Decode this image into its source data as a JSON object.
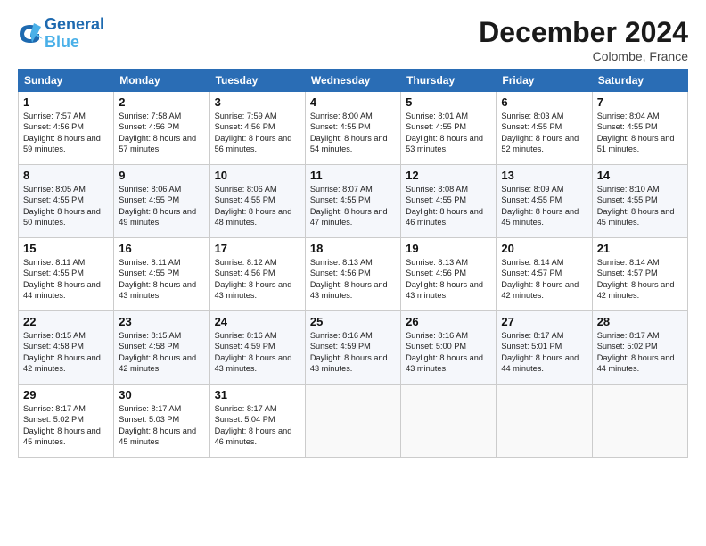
{
  "header": {
    "logo_line1": "General",
    "logo_line2": "Blue",
    "main_title": "December 2024",
    "subtitle": "Colombe, France"
  },
  "days_of_week": [
    "Sunday",
    "Monday",
    "Tuesday",
    "Wednesday",
    "Thursday",
    "Friday",
    "Saturday"
  ],
  "weeks": [
    [
      {
        "day": "1",
        "sunrise": "Sunrise: 7:57 AM",
        "sunset": "Sunset: 4:56 PM",
        "daylight": "Daylight: 8 hours and 59 minutes."
      },
      {
        "day": "2",
        "sunrise": "Sunrise: 7:58 AM",
        "sunset": "Sunset: 4:56 PM",
        "daylight": "Daylight: 8 hours and 57 minutes."
      },
      {
        "day": "3",
        "sunrise": "Sunrise: 7:59 AM",
        "sunset": "Sunset: 4:56 PM",
        "daylight": "Daylight: 8 hours and 56 minutes."
      },
      {
        "day": "4",
        "sunrise": "Sunrise: 8:00 AM",
        "sunset": "Sunset: 4:55 PM",
        "daylight": "Daylight: 8 hours and 54 minutes."
      },
      {
        "day": "5",
        "sunrise": "Sunrise: 8:01 AM",
        "sunset": "Sunset: 4:55 PM",
        "daylight": "Daylight: 8 hours and 53 minutes."
      },
      {
        "day": "6",
        "sunrise": "Sunrise: 8:03 AM",
        "sunset": "Sunset: 4:55 PM",
        "daylight": "Daylight: 8 hours and 52 minutes."
      },
      {
        "day": "7",
        "sunrise": "Sunrise: 8:04 AM",
        "sunset": "Sunset: 4:55 PM",
        "daylight": "Daylight: 8 hours and 51 minutes."
      }
    ],
    [
      {
        "day": "8",
        "sunrise": "Sunrise: 8:05 AM",
        "sunset": "Sunset: 4:55 PM",
        "daylight": "Daylight: 8 hours and 50 minutes."
      },
      {
        "day": "9",
        "sunrise": "Sunrise: 8:06 AM",
        "sunset": "Sunset: 4:55 PM",
        "daylight": "Daylight: 8 hours and 49 minutes."
      },
      {
        "day": "10",
        "sunrise": "Sunrise: 8:06 AM",
        "sunset": "Sunset: 4:55 PM",
        "daylight": "Daylight: 8 hours and 48 minutes."
      },
      {
        "day": "11",
        "sunrise": "Sunrise: 8:07 AM",
        "sunset": "Sunset: 4:55 PM",
        "daylight": "Daylight: 8 hours and 47 minutes."
      },
      {
        "day": "12",
        "sunrise": "Sunrise: 8:08 AM",
        "sunset": "Sunset: 4:55 PM",
        "daylight": "Daylight: 8 hours and 46 minutes."
      },
      {
        "day": "13",
        "sunrise": "Sunrise: 8:09 AM",
        "sunset": "Sunset: 4:55 PM",
        "daylight": "Daylight: 8 hours and 45 minutes."
      },
      {
        "day": "14",
        "sunrise": "Sunrise: 8:10 AM",
        "sunset": "Sunset: 4:55 PM",
        "daylight": "Daylight: 8 hours and 45 minutes."
      }
    ],
    [
      {
        "day": "15",
        "sunrise": "Sunrise: 8:11 AM",
        "sunset": "Sunset: 4:55 PM",
        "daylight": "Daylight: 8 hours and 44 minutes."
      },
      {
        "day": "16",
        "sunrise": "Sunrise: 8:11 AM",
        "sunset": "Sunset: 4:55 PM",
        "daylight": "Daylight: 8 hours and 43 minutes."
      },
      {
        "day": "17",
        "sunrise": "Sunrise: 8:12 AM",
        "sunset": "Sunset: 4:56 PM",
        "daylight": "Daylight: 8 hours and 43 minutes."
      },
      {
        "day": "18",
        "sunrise": "Sunrise: 8:13 AM",
        "sunset": "Sunset: 4:56 PM",
        "daylight": "Daylight: 8 hours and 43 minutes."
      },
      {
        "day": "19",
        "sunrise": "Sunrise: 8:13 AM",
        "sunset": "Sunset: 4:56 PM",
        "daylight": "Daylight: 8 hours and 43 minutes."
      },
      {
        "day": "20",
        "sunrise": "Sunrise: 8:14 AM",
        "sunset": "Sunset: 4:57 PM",
        "daylight": "Daylight: 8 hours and 42 minutes."
      },
      {
        "day": "21",
        "sunrise": "Sunrise: 8:14 AM",
        "sunset": "Sunset: 4:57 PM",
        "daylight": "Daylight: 8 hours and 42 minutes."
      }
    ],
    [
      {
        "day": "22",
        "sunrise": "Sunrise: 8:15 AM",
        "sunset": "Sunset: 4:58 PM",
        "daylight": "Daylight: 8 hours and 42 minutes."
      },
      {
        "day": "23",
        "sunrise": "Sunrise: 8:15 AM",
        "sunset": "Sunset: 4:58 PM",
        "daylight": "Daylight: 8 hours and 42 minutes."
      },
      {
        "day": "24",
        "sunrise": "Sunrise: 8:16 AM",
        "sunset": "Sunset: 4:59 PM",
        "daylight": "Daylight: 8 hours and 43 minutes."
      },
      {
        "day": "25",
        "sunrise": "Sunrise: 8:16 AM",
        "sunset": "Sunset: 4:59 PM",
        "daylight": "Daylight: 8 hours and 43 minutes."
      },
      {
        "day": "26",
        "sunrise": "Sunrise: 8:16 AM",
        "sunset": "Sunset: 5:00 PM",
        "daylight": "Daylight: 8 hours and 43 minutes."
      },
      {
        "day": "27",
        "sunrise": "Sunrise: 8:17 AM",
        "sunset": "Sunset: 5:01 PM",
        "daylight": "Daylight: 8 hours and 44 minutes."
      },
      {
        "day": "28",
        "sunrise": "Sunrise: 8:17 AM",
        "sunset": "Sunset: 5:02 PM",
        "daylight": "Daylight: 8 hours and 44 minutes."
      }
    ],
    [
      {
        "day": "29",
        "sunrise": "Sunrise: 8:17 AM",
        "sunset": "Sunset: 5:02 PM",
        "daylight": "Daylight: 8 hours and 45 minutes."
      },
      {
        "day": "30",
        "sunrise": "Sunrise: 8:17 AM",
        "sunset": "Sunset: 5:03 PM",
        "daylight": "Daylight: 8 hours and 45 minutes."
      },
      {
        "day": "31",
        "sunrise": "Sunrise: 8:17 AM",
        "sunset": "Sunset: 5:04 PM",
        "daylight": "Daylight: 8 hours and 46 minutes."
      },
      null,
      null,
      null,
      null
    ]
  ]
}
